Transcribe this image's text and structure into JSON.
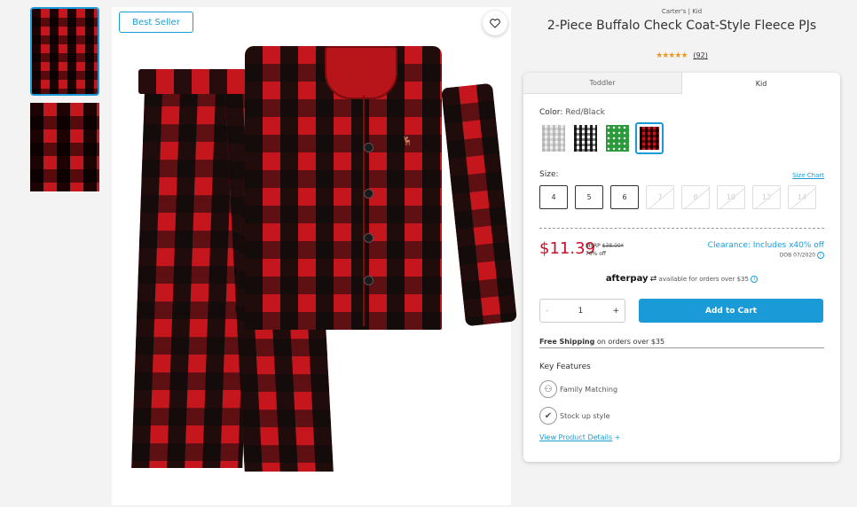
{
  "product": {
    "brand": "Carter's | Kid",
    "title": "2-Piece Buffalo Check Coat-Style Fleece PJs",
    "rating_stars": "★★★★★",
    "review_count": "(92)",
    "badge": "Best Seller"
  },
  "tabs": [
    {
      "label": "Toddler",
      "active": false
    },
    {
      "label": "Kid",
      "active": true
    }
  ],
  "color": {
    "label": "Color:",
    "value": "Red/Black",
    "swatch_names": [
      "gray-plaid-swatch",
      "black-white-plaid-swatch",
      "green-print-swatch",
      "red-black-plaid-swatch"
    ]
  },
  "size": {
    "label": "Size:",
    "chart_link": "Size Chart",
    "options": [
      {
        "label": "4",
        "available": true
      },
      {
        "label": "5",
        "available": true
      },
      {
        "label": "6",
        "available": true
      },
      {
        "label": "7",
        "available": false
      },
      {
        "label": "8",
        "available": false
      },
      {
        "label": "10",
        "available": false
      },
      {
        "label": "12",
        "available": false
      },
      {
        "label": "14",
        "available": false
      }
    ]
  },
  "pricing": {
    "price": "$11.39",
    "msrp_label": "MSRP",
    "msrp_value": "$38.00*",
    "discount": "70% off",
    "clearance": "Clearance: Includes x40% off",
    "dob": "DOB 07/2020"
  },
  "afterpay": {
    "logo": "afterpay",
    "text": "available for orders over $35"
  },
  "cart": {
    "minus": "-",
    "qty": "1",
    "plus": "+",
    "add_label": "Add to Cart"
  },
  "shipping": {
    "bold": "Free Shipping",
    "rest": " on orders over $35"
  },
  "features": {
    "title": "Key Features",
    "items": [
      {
        "label": "Family Matching",
        "icon": "family-icon"
      },
      {
        "label": "Stock up style",
        "icon": "check-icon"
      }
    ],
    "details_link": "View Product Details",
    "details_plus": "+"
  },
  "colors": {
    "accent": "#1a9bd7",
    "price": "#c8102e",
    "plaid_red": "#c4161c",
    "star": "#e79a23"
  }
}
